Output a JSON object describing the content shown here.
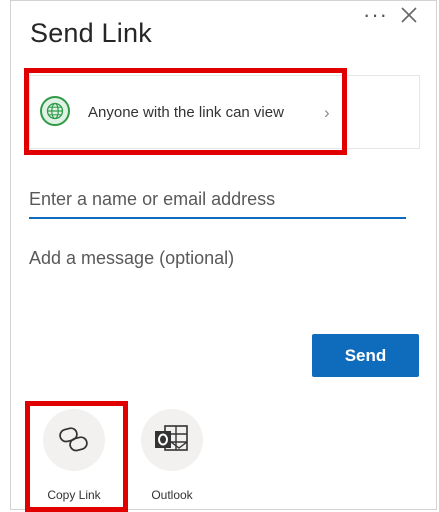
{
  "header": {
    "title": "Send Link",
    "more_glyph": "···"
  },
  "permission": {
    "label": "Anyone with the link can view",
    "chevron": "›"
  },
  "email": {
    "placeholder": "Enter a name or email address"
  },
  "message": {
    "placeholder": "Add a message (optional)"
  },
  "send_button": {
    "label": "Send"
  },
  "share_options": [
    {
      "label": "Copy Link",
      "icon": "link-icon"
    },
    {
      "label": "Outlook",
      "icon": "outlook-icon"
    }
  ],
  "colors": {
    "accent": "#0f6cbd",
    "highlight": "#e10000",
    "globe_green": "#2f9a48"
  }
}
